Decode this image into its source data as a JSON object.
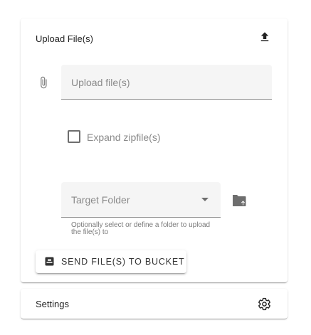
{
  "upload_panel": {
    "title": "Upload File(s)",
    "upload_icon": "upload-icon",
    "attach_icon": "paperclip-icon",
    "file_input": {
      "placeholder": "Upload file(s)",
      "value": ""
    },
    "expand_zip": {
      "label": "Expand zipfile(s)",
      "checked": false
    },
    "target_folder": {
      "label": "Target Folder",
      "selected": "",
      "hint": "Optionally select or define a folder to upload the file(s) to"
    },
    "folder_icon": "folder-upload-icon",
    "send_button": {
      "label": "SEND FILE(S) TO BUCKET",
      "icon": "send-icon"
    }
  },
  "settings_panel": {
    "title": "Settings",
    "icon": "gear-icon"
  },
  "colors": {
    "icon_dark": "#222222",
    "icon_grey": "#6e6e6e",
    "field_bg": "#f5f5f5",
    "placeholder": "#8a8a8a"
  }
}
